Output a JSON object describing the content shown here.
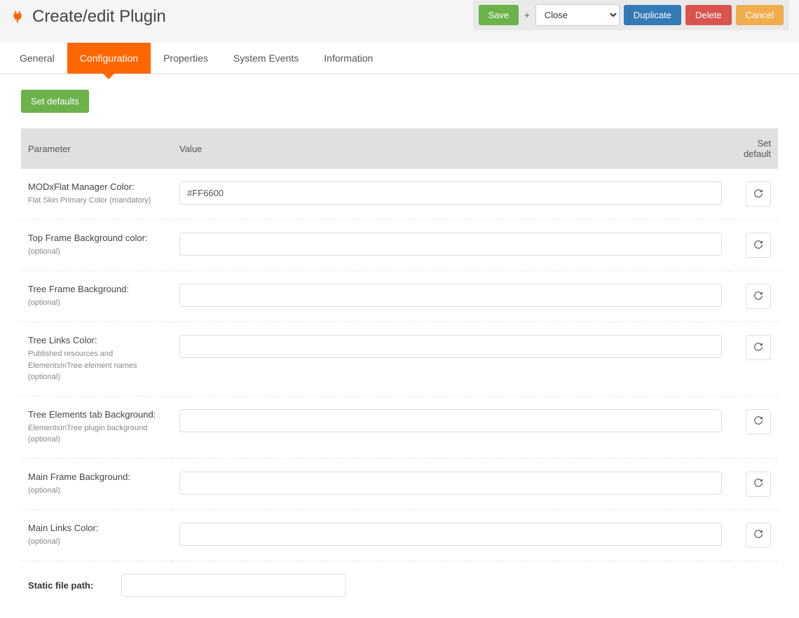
{
  "header": {
    "title": "Create/edit Plugin",
    "save_label": "Save",
    "plus": "+",
    "close_option": "Close",
    "duplicate_label": "Duplicate",
    "delete_label": "Delete",
    "cancel_label": "Cancel"
  },
  "tabs": {
    "general": "General",
    "configuration": "Configuration",
    "properties": "Properties",
    "system_events": "System Events",
    "information": "Information",
    "active": "configuration"
  },
  "set_defaults_label": "Set defaults",
  "table_headers": {
    "parameter": "Parameter",
    "value": "Value",
    "set_default": "Set default"
  },
  "rows": [
    {
      "label": "MODxFlat Manager Color:",
      "help": "Flat Skin Primary Color (mandatory)",
      "value": "#FF6600"
    },
    {
      "label": "Top Frame Background color:",
      "help": "(optional)",
      "value": ""
    },
    {
      "label": "Tree Frame Background:",
      "help": "(optional)",
      "value": ""
    },
    {
      "label": "Tree Links Color:",
      "help": "Published resources and ElementsInTree element names (optional)",
      "value": ""
    },
    {
      "label": "Tree Elements tab Background:",
      "help": "ElementsInTree plugin background (optional)",
      "value": ""
    },
    {
      "label": "Main Frame Background:",
      "help": "(optional)",
      "value": ""
    },
    {
      "label": "Main Links Color:",
      "help": "(optional)",
      "value": ""
    }
  ],
  "static_file": {
    "label": "Static file path:",
    "value": ""
  },
  "colors": {
    "accent": "#FF6600",
    "green": "#6cb24a",
    "blue": "#337ab7",
    "red": "#d9534f",
    "yellow": "#f0ad4e"
  }
}
